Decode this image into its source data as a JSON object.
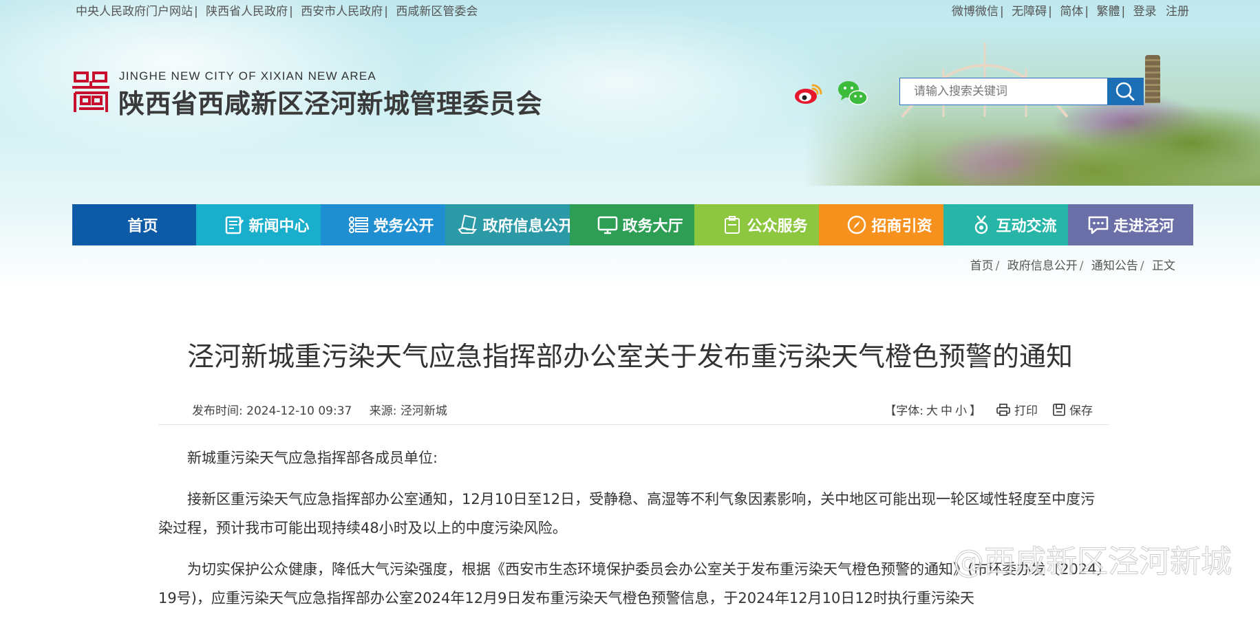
{
  "top_links": {
    "left": [
      "中央人民政府门户网站",
      "陕西省人民政府",
      "西安市人民政府",
      "西咸新区管委会"
    ],
    "right": [
      "微博微信",
      "无障碍",
      "简体",
      "繁體",
      "登录",
      "注册"
    ]
  },
  "header": {
    "logo_en": "JINGHE NEW CITY OF XIXIAN NEW AREA",
    "logo_cn": "陕西省西咸新区泾河新城管理委员会",
    "search_placeholder": "请输入搜索关键词"
  },
  "nav": {
    "items": [
      {
        "label": "首页",
        "color": "#0d5aa7",
        "icon": "none"
      },
      {
        "label": "新闻中心",
        "color": "#19aecb",
        "icon": "news-icon"
      },
      {
        "label": "党务公开",
        "color": "#1f8fd1",
        "icon": "list-icon"
      },
      {
        "label": "政府信息公开",
        "color": "#2c9aa6",
        "icon": "document-hand-icon"
      },
      {
        "label": "政务大厅",
        "color": "#2e9e54",
        "icon": "monitor-icon"
      },
      {
        "label": "公众服务",
        "color": "#8dc63f",
        "icon": "clipboard-icon"
      },
      {
        "label": "招商引资",
        "color": "#f7911e",
        "icon": "compass-icon"
      },
      {
        "label": "互动交流",
        "color": "#26b5a6",
        "icon": "medal-icon"
      },
      {
        "label": "走进泾河",
        "color": "#6b6fa8",
        "icon": "chat-icon"
      }
    ]
  },
  "breadcrumb": [
    "首页",
    "政府信息公开",
    "通知公告",
    "正文"
  ],
  "article": {
    "title": "泾河新城重污染天气应急指挥部办公室关于发布重污染天气橙色预警的通知",
    "publish_label": "发布时间:",
    "publish_time": "2024-12-10 09:37",
    "source_label": "来源:",
    "source": "泾河新城",
    "font_label": "【字体:",
    "font_sizes": [
      "大",
      "中",
      "小"
    ],
    "font_close": "】",
    "print_label": "打印",
    "save_label": "保存",
    "paragraphs": [
      "新城重污染天气应急指挥部各成员单位:",
      "接新区重污染天气应急指挥部办公室通知，12月10日至12日，受静稳、高湿等不利气象因素影响，关中地区可能出现一轮区域性轻度至中度污染过程，预计我市可能出现持续48小时及以上的中度污染风险。",
      "为切实保护公众健康，降低大气污染强度，根据《西安市生态环境保护委员会办公室关于发布重污染天气橙色预警的通知》(市环委办发〔2024〕19号)，应重污染天气应急指挥部办公室2024年12月9日发布重污染天气橙色预警信息，于2024年12月10日12时执行重污染天"
    ]
  },
  "watermark": "@西咸新区泾河新城"
}
